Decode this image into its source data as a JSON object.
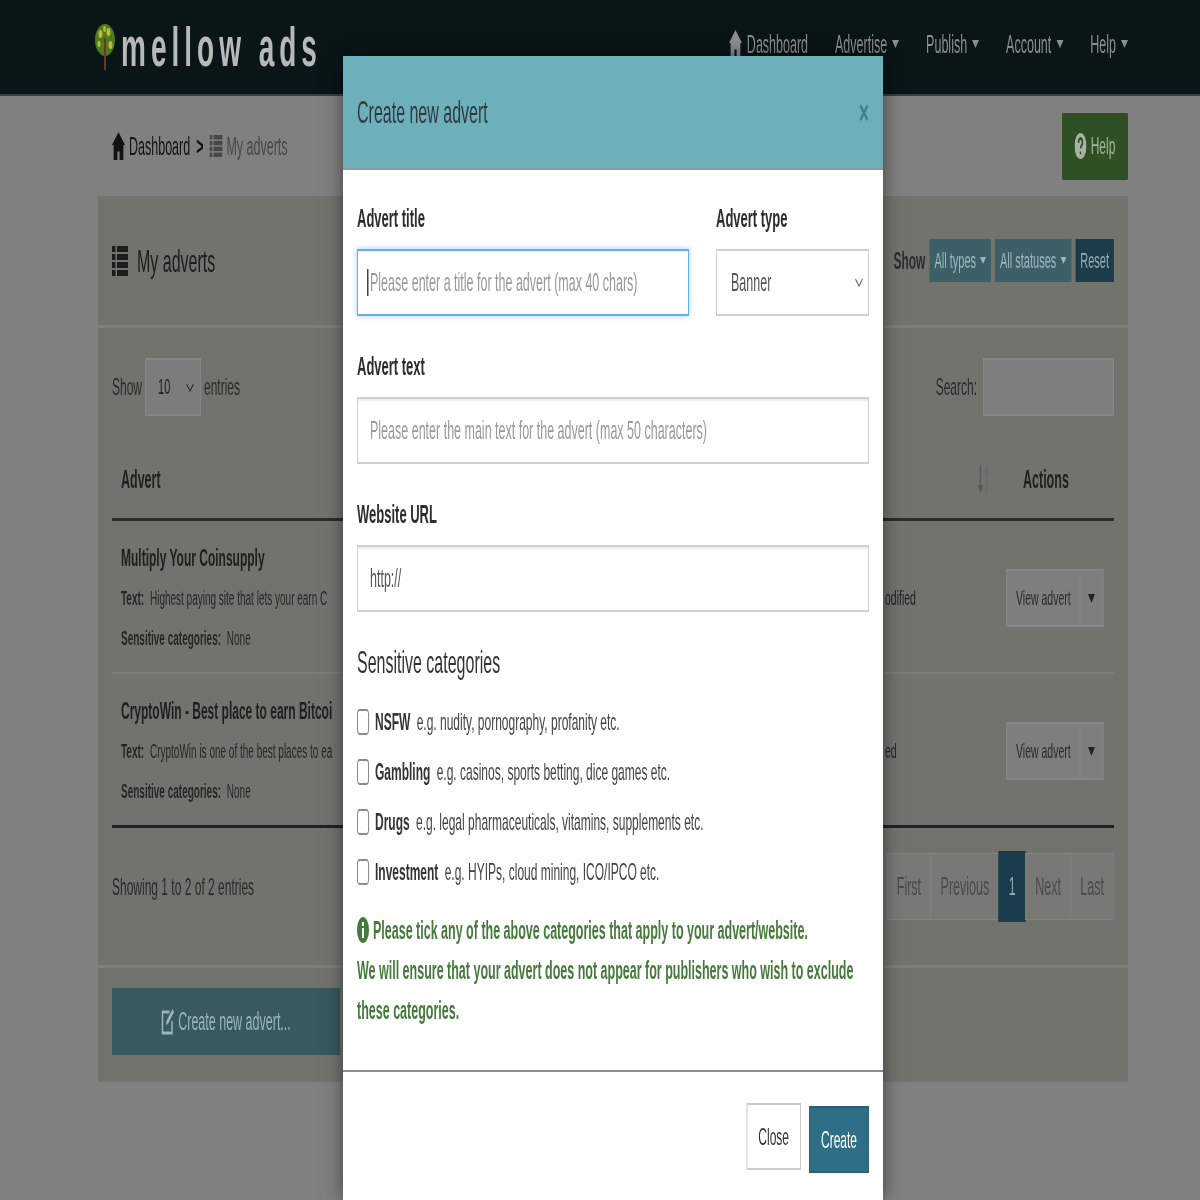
{
  "navbar": {
    "logo": "mellow ads",
    "items": [
      {
        "label": "Dashboard",
        "dropdown": false
      },
      {
        "label": "Advertise",
        "dropdown": true
      },
      {
        "label": "Publish",
        "dropdown": true
      },
      {
        "label": "Account",
        "dropdown": true
      },
      {
        "label": "Help",
        "dropdown": true
      }
    ]
  },
  "breadcrumb": {
    "separator": ">",
    "items": [
      {
        "label": "Dashboard",
        "current": false
      },
      {
        "label": "My adverts",
        "current": true
      }
    ]
  },
  "help_button": {
    "label": "Help"
  },
  "panel": {
    "title": "My adverts",
    "filter_label": "Show",
    "filters": [
      {
        "label": "All types",
        "kind": "dropdown"
      },
      {
        "label": "All statuses",
        "kind": "dropdown"
      },
      {
        "label": "Reset",
        "kind": "button"
      }
    ],
    "length": {
      "label": "Show",
      "value": "10",
      "suffix": "entries"
    },
    "search": {
      "label": "Search:"
    },
    "table": {
      "columns": [
        "Advert",
        "Actions"
      ],
      "rows": [
        {
          "title": "Multiply Your Coinsupply",
          "text": "**Text:** Highest paying site that lets your earn C",
          "categories": "**Sensitive categories:** None",
          "status": "odified",
          "action": "View advert"
        },
        {
          "title": "CryptoWin - Best place to earn Bitcoi",
          "text": "**Text:** CryptoWin is one of the best places to ea",
          "categories": "**Sensitive categories:** None",
          "status": "ed",
          "action": "View advert"
        }
      ]
    },
    "info": "Showing 1 to 2 of 2 entries",
    "pages": [
      {
        "label": "First",
        "selected": false
      },
      {
        "label": "Previous",
        "selected": false
      },
      {
        "label": "1",
        "selected": true
      },
      {
        "label": "Next",
        "selected": false
      },
      {
        "label": "Last",
        "selected": false
      }
    ],
    "create_button": {
      "label": "Create new advert..."
    }
  },
  "modal": {
    "title": "Create new advert",
    "close": "×",
    "field_rows": [
      {
        "fields": [
          {
            "label": "Advert title",
            "kind": "text",
            "placeholder": "Please enter a title for the advert (max 40 chars)",
            "focused": true
          },
          {
            "label": "Advert type",
            "kind": "select",
            "value": "Banner",
            "focused": false
          }
        ]
      },
      {
        "fields": [
          {
            "label": "Advert text",
            "kind": "text",
            "placeholder": "Please enter the main text for the advert (max 50 characters)",
            "focused": false
          }
        ]
      },
      {
        "fields": [
          {
            "label": "Website URL",
            "kind": "text",
            "value": "http://",
            "focused": false
          }
        ]
      }
    ],
    "categories_heading": "Sensitive categories",
    "categories": [
      {
        "name": "NSFW",
        "examples": "e.g. nudity, pornography, profanity etc.",
        "checked": false
      },
      {
        "name": "Gambling",
        "examples": "e.g. casinos, sports betting, dice games etc.",
        "checked": false
      },
      {
        "name": "Drugs",
        "examples": "e.g. legal pharmaceuticals, vitamins, supplements etc.",
        "checked": false
      },
      {
        "name": "Investment",
        "examples": "e.g. HYIPs, cloud mining, ICO/IPCO etc.",
        "checked": false
      }
    ],
    "notice": {
      "lead": "Please tick any of the above categories that apply to your advert/website.",
      "text": "We will ensure that your advert does not appear for publishers who wish to exclude these categories."
    },
    "buttons": [
      {
        "label": "Close",
        "kind": "default"
      },
      {
        "label": "Create",
        "kind": "primary"
      }
    ]
  }
}
